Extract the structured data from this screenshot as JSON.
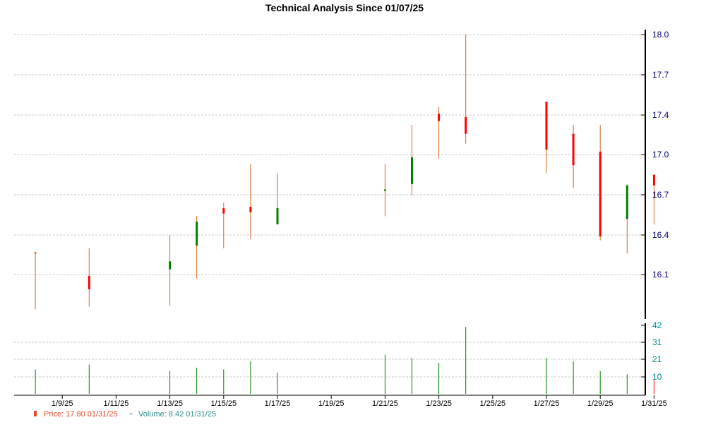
{
  "chart_data": {
    "type": "candlestick",
    "title": "Technical Analysis Since 01/07/25",
    "x_tick_labels": [
      "1/9/25",
      "1/11/25",
      "1/13/25",
      "1/15/25",
      "1/17/25",
      "1/19/25",
      "1/21/25",
      "1/23/25",
      "1/25/25",
      "1/27/25",
      "1/29/25",
      "1/31/25"
    ],
    "price_axis": {
      "ticks": [
        "16.1",
        "16.4",
        "16.7",
        "17.0",
        "17.4",
        "17.7",
        "18.0"
      ],
      "range": [
        15.8,
        18.0
      ]
    },
    "volume_axis": {
      "ticks": [
        "10",
        "21",
        "31",
        "42"
      ],
      "range": [
        0,
        42
      ]
    },
    "candles": [
      {
        "date": "1/8/25",
        "open": 16.27,
        "high": 16.27,
        "low": 15.84,
        "close": 16.27,
        "color": "#d2691e",
        "volume": 15
      },
      {
        "date": "1/10/25",
        "open": 16.09,
        "high": 16.3,
        "low": 15.86,
        "close": 15.99,
        "color": "#ff0000",
        "volume": 18
      },
      {
        "date": "1/13/25",
        "open": 16.14,
        "high": 16.4,
        "low": 15.87,
        "close": 16.2,
        "color": "#008000",
        "volume": 14
      },
      {
        "date": "1/14/25",
        "open": 16.32,
        "high": 16.54,
        "low": 16.07,
        "close": 16.5,
        "color": "#008000",
        "volume": 16
      },
      {
        "date": "1/15/25",
        "open": 16.6,
        "high": 16.64,
        "low": 16.3,
        "close": 16.56,
        "color": "#ff0000",
        "volume": 15
      },
      {
        "date": "1/16/25",
        "open": 16.61,
        "high": 16.93,
        "low": 16.37,
        "close": 16.57,
        "color": "#ff0000",
        "volume": 20
      },
      {
        "date": "1/17/25",
        "open": 16.48,
        "high": 16.86,
        "low": 16.48,
        "close": 16.6,
        "color": "#008000",
        "volume": 13
      },
      {
        "date": "1/21/25",
        "open": 16.73,
        "high": 16.93,
        "low": 16.54,
        "close": 16.74,
        "color": "#008000",
        "volume": 24
      },
      {
        "date": "1/22/25",
        "open": 16.78,
        "high": 17.3,
        "low": 16.7,
        "close": 16.98,
        "color": "#008000",
        "volume": 22
      },
      {
        "date": "1/23/25",
        "open": 17.41,
        "high": 17.46,
        "low": 16.97,
        "close": 17.34,
        "color": "#ff0000",
        "volume": 19
      },
      {
        "date": "1/24/25",
        "open": 17.38,
        "high": 18.0,
        "low": 17.11,
        "close": 17.21,
        "color": "#ff0000",
        "volume": 41
      },
      {
        "date": "1/27/25",
        "open": 17.5,
        "high": 17.5,
        "low": 16.86,
        "close": 17.05,
        "color": "#ff0000",
        "volume": 22
      },
      {
        "date": "1/28/25",
        "open": 17.21,
        "high": 17.3,
        "low": 16.75,
        "close": 16.92,
        "color": "#ff0000",
        "volume": 20
      },
      {
        "date": "1/29/25",
        "open": 17.03,
        "high": 17.3,
        "low": 16.36,
        "close": 16.39,
        "color": "#ff0000",
        "volume": 14
      },
      {
        "date": "1/30/25",
        "open": 16.52,
        "high": 16.78,
        "low": 16.26,
        "close": 16.77,
        "color": "#008000",
        "volume": 12
      },
      {
        "date": "1/31/25",
        "open": 16.85,
        "high": 16.85,
        "low": 16.48,
        "close": 16.77,
        "color": "#ff0000",
        "volume": 8.42
      }
    ],
    "grid": true,
    "legend": {
      "placement": "bottom-left",
      "price_label": "Price: 17.80  01/31/25",
      "volume_label": "Volume: 8.42  01/31/25",
      "price_color": "#e8452c",
      "volume_color": "#2e8b8b"
    },
    "colors": {
      "up": "#008000",
      "down": "#ff0000",
      "wick": "#d2691e",
      "volume": "#008000",
      "price_tick": "#000080",
      "volume_tick": "#008b8b"
    }
  }
}
